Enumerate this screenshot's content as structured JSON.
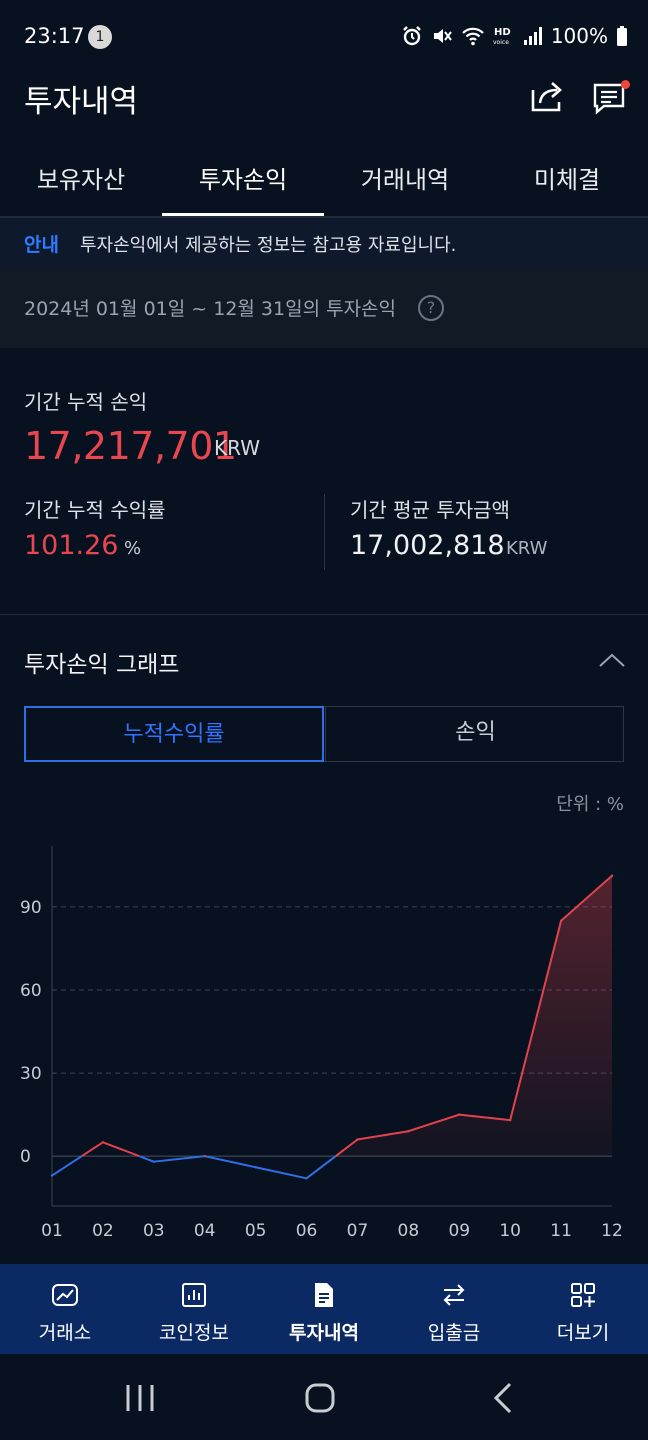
{
  "status_bar": {
    "time": "23:17",
    "notification_count": "1",
    "battery": "100%",
    "icons": [
      "alarm-icon",
      "mute-icon",
      "wifi-icon",
      "hd-voice-icon",
      "signal-icon",
      "battery-icon"
    ]
  },
  "header": {
    "title": "투자내역",
    "share_icon": "share-icon",
    "board_icon": "message-board-icon"
  },
  "tabs": [
    {
      "label": "보유자산",
      "active": false
    },
    {
      "label": "투자손익",
      "active": true
    },
    {
      "label": "거래내역",
      "active": false
    },
    {
      "label": "미체결",
      "active": false
    }
  ],
  "notice": {
    "tag": "안내",
    "text": "투자손익에서 제공하는 정보는 참고용 자료입니다."
  },
  "period": {
    "text": "2024년 01월 01일 ~ 12월 31일의 투자손익",
    "help": "?"
  },
  "summary": {
    "cumulative_pnl_label": "기간 누적 손익",
    "cumulative_pnl_value": "17,217,701",
    "cumulative_pnl_unit": "KRW",
    "return_rate_label": "기간 누적 수익률",
    "return_rate_value": "101.26",
    "return_rate_unit": "%",
    "avg_invest_label": "기간 평균 투자금액",
    "avg_invest_value": "17,002,818",
    "avg_invest_unit": "KRW"
  },
  "graph": {
    "title": "투자손익 그래프",
    "segments": [
      {
        "label": "누적수익률",
        "active": true
      },
      {
        "label": "손익",
        "active": false
      }
    ],
    "unit_label": "단위 : %"
  },
  "chart_data": {
    "type": "line",
    "x": [
      "01",
      "02",
      "03",
      "04",
      "05",
      "06",
      "07",
      "08",
      "09",
      "10",
      "11",
      "12"
    ],
    "series": [
      {
        "values": [
          -7,
          5,
          -2,
          0,
          -4,
          -8,
          6,
          9,
          15,
          13,
          85,
          101.26
        ]
      }
    ],
    "y_ticks": [
      "0",
      "30",
      "60",
      "90"
    ],
    "ylim": [
      -18,
      112
    ],
    "positive_color": "#e0434d",
    "negative_color": "#2f6fe6",
    "grid": "horizontal dashed"
  },
  "bottom_nav": [
    {
      "label": "거래소",
      "icon": "exchange-chart-icon",
      "active": false
    },
    {
      "label": "코인정보",
      "icon": "coin-info-icon",
      "active": false
    },
    {
      "label": "투자내역",
      "icon": "document-icon",
      "active": true
    },
    {
      "label": "입출금",
      "icon": "transfer-icon",
      "active": false
    },
    {
      "label": "더보기",
      "icon": "more-grid-icon",
      "active": false
    }
  ],
  "system_nav": [
    "recent-apps-icon",
    "home-icon",
    "back-icon"
  ]
}
